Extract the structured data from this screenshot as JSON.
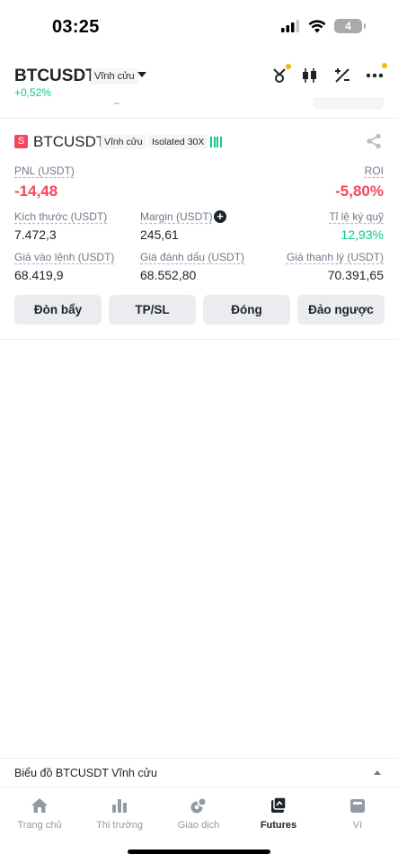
{
  "status_bar": {
    "time": "03:25",
    "battery": "4"
  },
  "header": {
    "pair": "BTCUSDT",
    "perpetual_badge": "Vĩnh cửu",
    "change_pct": "+0,52%"
  },
  "position": {
    "side_badge": "S",
    "symbol": "BTCUSDT",
    "tag_perpetual": "Vĩnh cửu",
    "tag_margin": "Isolated 30X",
    "pnl_label": "PNL (USDT)",
    "pnl_value": "-14,48",
    "roi_label": "ROI",
    "roi_value": "-5,80%",
    "size_label": "Kích thước (USDT)",
    "size_value": "7.472,3",
    "margin_label": "Margin (USDT)",
    "margin_value": "245,61",
    "margin_ratio_label": "Tỉ lệ ký quỹ",
    "margin_ratio_value": "12,93%",
    "entry_label": "Giá vào lệnh (USDT)",
    "entry_value": "68.419,9",
    "mark_label": "Giá đánh dấu (USDT)",
    "mark_value": "68.552,80",
    "liq_label": "Giá thanh lý (USDT)",
    "liq_value": "70.391,65"
  },
  "actions": {
    "leverage": "Đòn bẩy",
    "tpsl": "TP/SL",
    "close": "Đóng",
    "reverse": "Đảo ngược"
  },
  "chart_bar": {
    "label": "Biểu đồ BTCUSDT Vĩnh cửu"
  },
  "bottom_nav": [
    {
      "label": "Trang chủ",
      "icon": "home-icon"
    },
    {
      "label": "Thị trường",
      "icon": "markets-icon"
    },
    {
      "label": "Giao dịch",
      "icon": "trade-icon"
    },
    {
      "label": "Futures",
      "icon": "futures-icon",
      "active": true
    },
    {
      "label": "Ví",
      "icon": "wallet-icon"
    }
  ],
  "colors": {
    "red": "#f6465d",
    "green": "#0ecb81",
    "accent": "#f0b90b",
    "text": "#1e2329",
    "muted": "#707a8a"
  }
}
